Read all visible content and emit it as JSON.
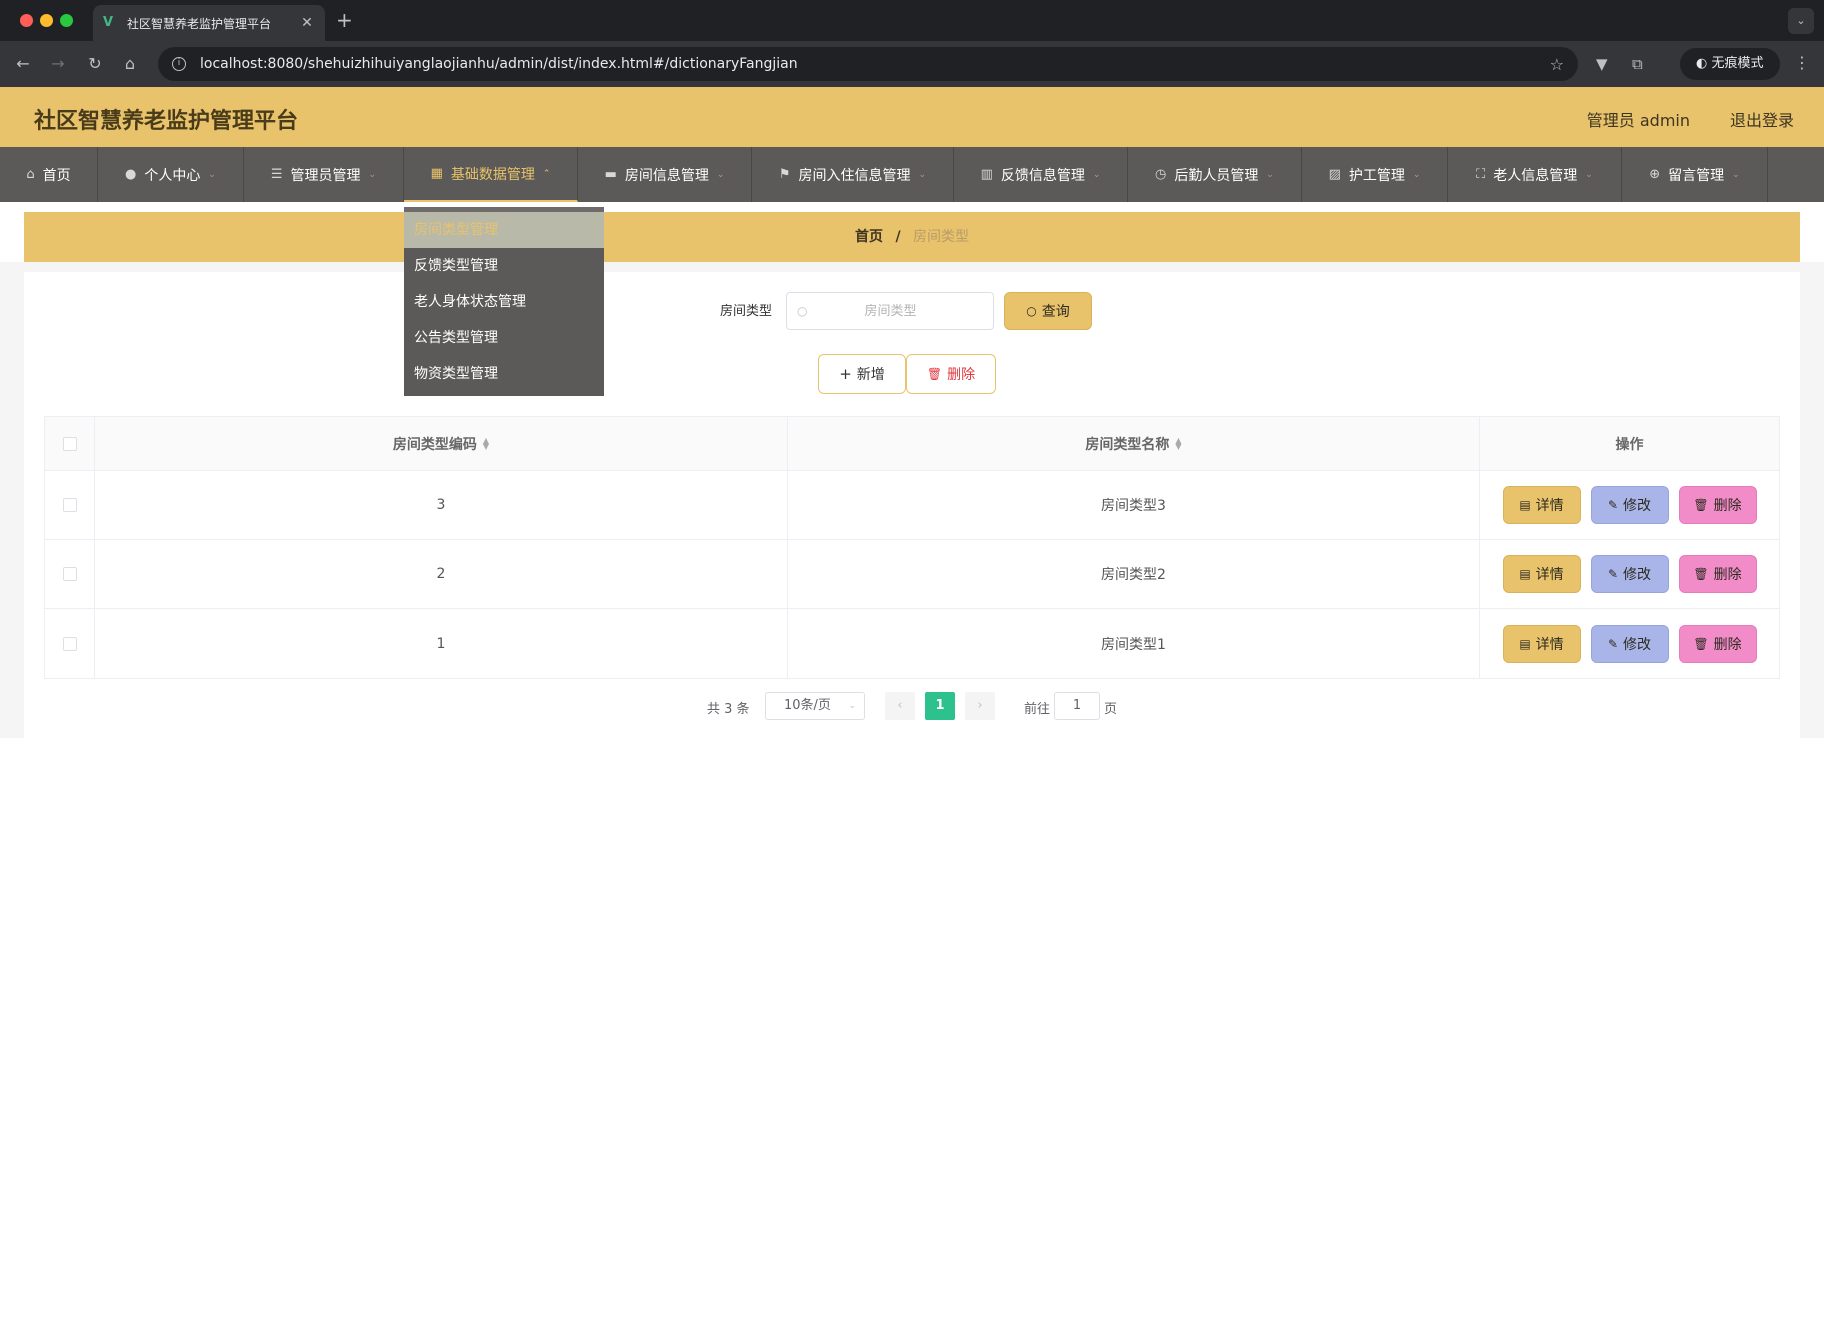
{
  "browser": {
    "tab_title": "社区智慧养老监护管理平台",
    "url": "localhost:8080/shehuizhihuiyanglaojianhu/admin/dist/index.html#/dictionaryFangjian",
    "incognito_label": "无痕模式"
  },
  "header": {
    "title": "社区智慧养老监护管理平台",
    "admin_label": "管理员 admin",
    "logout_label": "退出登录"
  },
  "menu": [
    {
      "label": "首页",
      "icon": "home-icon",
      "chevron": false
    },
    {
      "label": "个人中心",
      "icon": "user-icon",
      "chevron": true
    },
    {
      "label": "管理员管理",
      "icon": "list-icon",
      "chevron": true
    },
    {
      "label": "基础数据管理",
      "icon": "grid-icon",
      "chevron": true,
      "active": true
    },
    {
      "label": "房间信息管理",
      "icon": "briefcase-icon",
      "chevron": true
    },
    {
      "label": "房间入住信息管理",
      "icon": "flag-icon",
      "chevron": true
    },
    {
      "label": "反馈信息管理",
      "icon": "chart-icon",
      "chevron": true
    },
    {
      "label": "后勤人员管理",
      "icon": "clock-icon",
      "chevron": true
    },
    {
      "label": "护工管理",
      "icon": "trend-icon",
      "chevron": true
    },
    {
      "label": "老人信息管理",
      "icon": "fullscreen-icon",
      "chevron": true
    },
    {
      "label": "留言管理",
      "icon": "target-icon",
      "chevron": true
    }
  ],
  "dropdown": [
    "房间类型管理",
    "反馈类型管理",
    "老人身体状态管理",
    "公告类型管理",
    "物资类型管理"
  ],
  "breadcrumb": {
    "home": "首页",
    "separator": "/",
    "current": "房间类型"
  },
  "search": {
    "label": "房间类型",
    "placeholder": "房间类型",
    "button": "查询"
  },
  "actions": {
    "add": "新增",
    "delete": "删除"
  },
  "table": {
    "columns": [
      "房间类型编码",
      "房间类型名称",
      "操作"
    ],
    "rows": [
      {
        "code": "3",
        "name": "房间类型3"
      },
      {
        "code": "2",
        "name": "房间类型2"
      },
      {
        "code": "1",
        "name": "房间类型1"
      }
    ],
    "row_buttons": {
      "detail": "详情",
      "edit": "修改",
      "delete": "删除"
    }
  },
  "pagination": {
    "total": "共 3 条",
    "page_size": "10条/页",
    "current_page": "1",
    "goto_label": "前往",
    "goto_value": "1",
    "page_suffix": "页"
  },
  "colors": {
    "accent": "#e8c36b",
    "menubar": "#5c5a58",
    "page_active": "#2dc18d",
    "edit_button": "#a9b5e8",
    "delete_button": "#f28cc8"
  }
}
